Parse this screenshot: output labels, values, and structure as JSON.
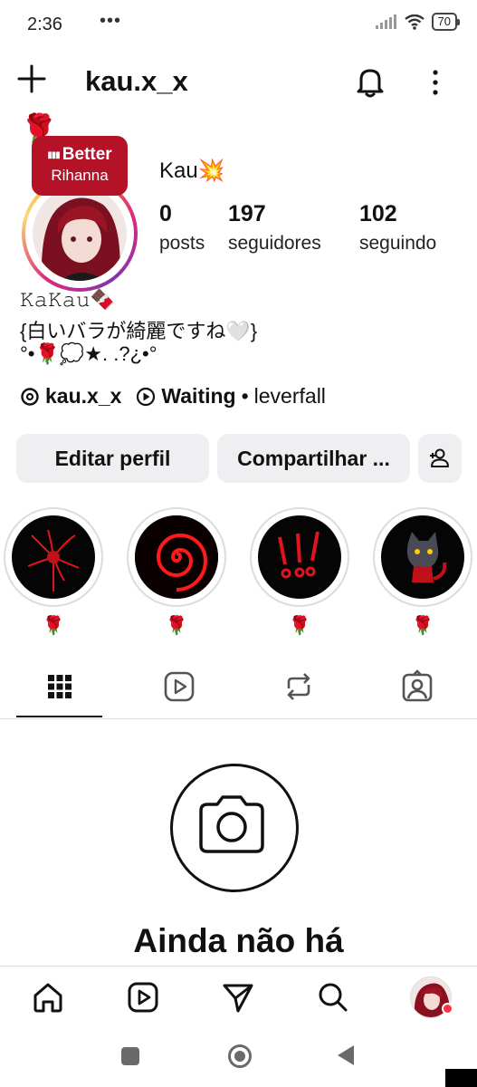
{
  "status_bar": {
    "time": "2:36",
    "dots": "•••",
    "battery": "70"
  },
  "header": {
    "username": "kau.x_x",
    "icons": [
      "plus-icon",
      "bell-icon",
      "kebab-menu-icon"
    ]
  },
  "note": {
    "line1": "Better",
    "line2": "Rihanna",
    "rose": "🌹"
  },
  "profile": {
    "display_name": "Kau💥",
    "stats": [
      {
        "value": "0",
        "label": "posts"
      },
      {
        "value": "197",
        "label": "seguidores"
      },
      {
        "value": "102",
        "label": "seguindo"
      }
    ]
  },
  "bio": {
    "line1": "𝙺𝚊𝙺𝚊𝚞🍫",
    "line2": "{白いバラが綺麗ですね🤍}",
    "line3": "°•🌹💭★. .?¿•°"
  },
  "links": {
    "threads_handle": "kau.x_x",
    "music_song": "Waiting",
    "music_separator": "•",
    "music_artist": "leverfall"
  },
  "buttons": {
    "edit": "Editar perfil",
    "share": "Compartilhar ..."
  },
  "highlights": [
    {
      "label": "🌹",
      "icon": "red-spider-lily"
    },
    {
      "label": "🌹",
      "icon": "red-spiral"
    },
    {
      "label": "🌹",
      "icon": "red-exclamation-marks"
    },
    {
      "label": "🌹",
      "icon": "red-cat"
    }
  ],
  "tabs": [
    "grid-icon",
    "reels-icon",
    "reposts-icon",
    "tagged-icon"
  ],
  "empty_state": {
    "title": "Ainda não há"
  },
  "bottom_nav": [
    "home-icon",
    "reels-icon",
    "send-icon",
    "search-icon",
    "profile-avatar"
  ],
  "colors": {
    "accent_red": "#b31227",
    "notification_dot": "#ff3040"
  }
}
